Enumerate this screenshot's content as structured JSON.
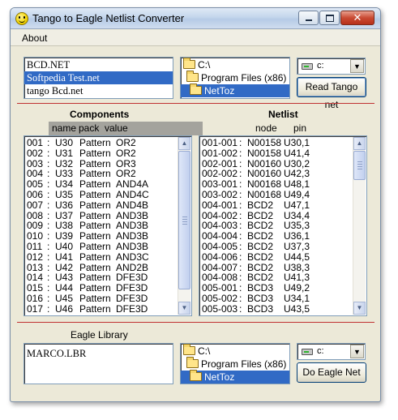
{
  "window": {
    "title": "Tango to Eagle Netlist Converter"
  },
  "menu": {
    "about": "About"
  },
  "tango_files": [
    "BCD.NET",
    "Softpedia Test.net",
    "tango Bcd.net"
  ],
  "dirs": [
    "C:\\",
    "Program Files (x86)",
    "NetToz"
  ],
  "drive": {
    "value": "c:"
  },
  "buttons": {
    "read_tango": "Read Tango net",
    "do_eagle": "Do Eagle Net"
  },
  "components": {
    "title": "Components",
    "columns": {
      "name": "name",
      "pack": "pack",
      "value": "value"
    },
    "rows": [
      [
        "001",
        "U30",
        "Pattern",
        "OR2"
      ],
      [
        "002",
        "U31",
        "Pattern",
        "OR2"
      ],
      [
        "003",
        "U32",
        "Pattern",
        "OR3"
      ],
      [
        "004",
        "U33",
        "Pattern",
        "OR2"
      ],
      [
        "005",
        "U34",
        "Pattern",
        "AND4A"
      ],
      [
        "006",
        "U35",
        "Pattern",
        "AND4C"
      ],
      [
        "007",
        "U36",
        "Pattern",
        "AND4B"
      ],
      [
        "008",
        "U37",
        "Pattern",
        "AND3B"
      ],
      [
        "009",
        "U38",
        "Pattern",
        "AND3B"
      ],
      [
        "010",
        "U39",
        "Pattern",
        "AND3B"
      ],
      [
        "011",
        "U40",
        "Pattern",
        "AND3B"
      ],
      [
        "012",
        "U41",
        "Pattern",
        "AND3C"
      ],
      [
        "013",
        "U42",
        "Pattern",
        "AND2B"
      ],
      [
        "014",
        "U43",
        "Pattern",
        "DFE3D"
      ],
      [
        "015",
        "U44",
        "Pattern",
        "DFE3D"
      ],
      [
        "016",
        "U45",
        "Pattern",
        "DFE3D"
      ],
      [
        "017",
        "U46",
        "Pattern",
        "DFE3D"
      ]
    ]
  },
  "netlist": {
    "title": "Netlist",
    "columns": {
      "node": "node",
      "pin": "pin"
    },
    "rows": [
      [
        "001-001",
        "N00158",
        "U30,1"
      ],
      [
        "001-002",
        "N00158",
        "U41,4"
      ],
      [
        "002-001",
        "N00160",
        "U30,2"
      ],
      [
        "002-002",
        "N00160",
        "U42,3"
      ],
      [
        "003-001",
        "N00168",
        "U48,1"
      ],
      [
        "003-002",
        "N00168",
        "U49,4"
      ],
      [
        "004-001",
        "BCD2",
        "U47,1"
      ],
      [
        "004-002",
        "BCD2",
        "U34,4"
      ],
      [
        "004-003",
        "BCD2",
        "U35,3"
      ],
      [
        "004-004",
        "BCD2",
        "U36,1"
      ],
      [
        "004-005",
        "BCD2",
        "U37,3"
      ],
      [
        "004-006",
        "BCD2",
        "U44,5"
      ],
      [
        "004-007",
        "BCD2",
        "U38,3"
      ],
      [
        "004-008",
        "BCD2",
        "U41,3"
      ],
      [
        "005-001",
        "BCD3",
        "U49,2"
      ],
      [
        "005-002",
        "BCD3",
        "U34,1"
      ],
      [
        "005-003",
        "BCD3",
        "U43,5"
      ]
    ]
  },
  "eagle": {
    "title": "Eagle Library",
    "files": [
      "MARCO.LBR"
    ]
  }
}
